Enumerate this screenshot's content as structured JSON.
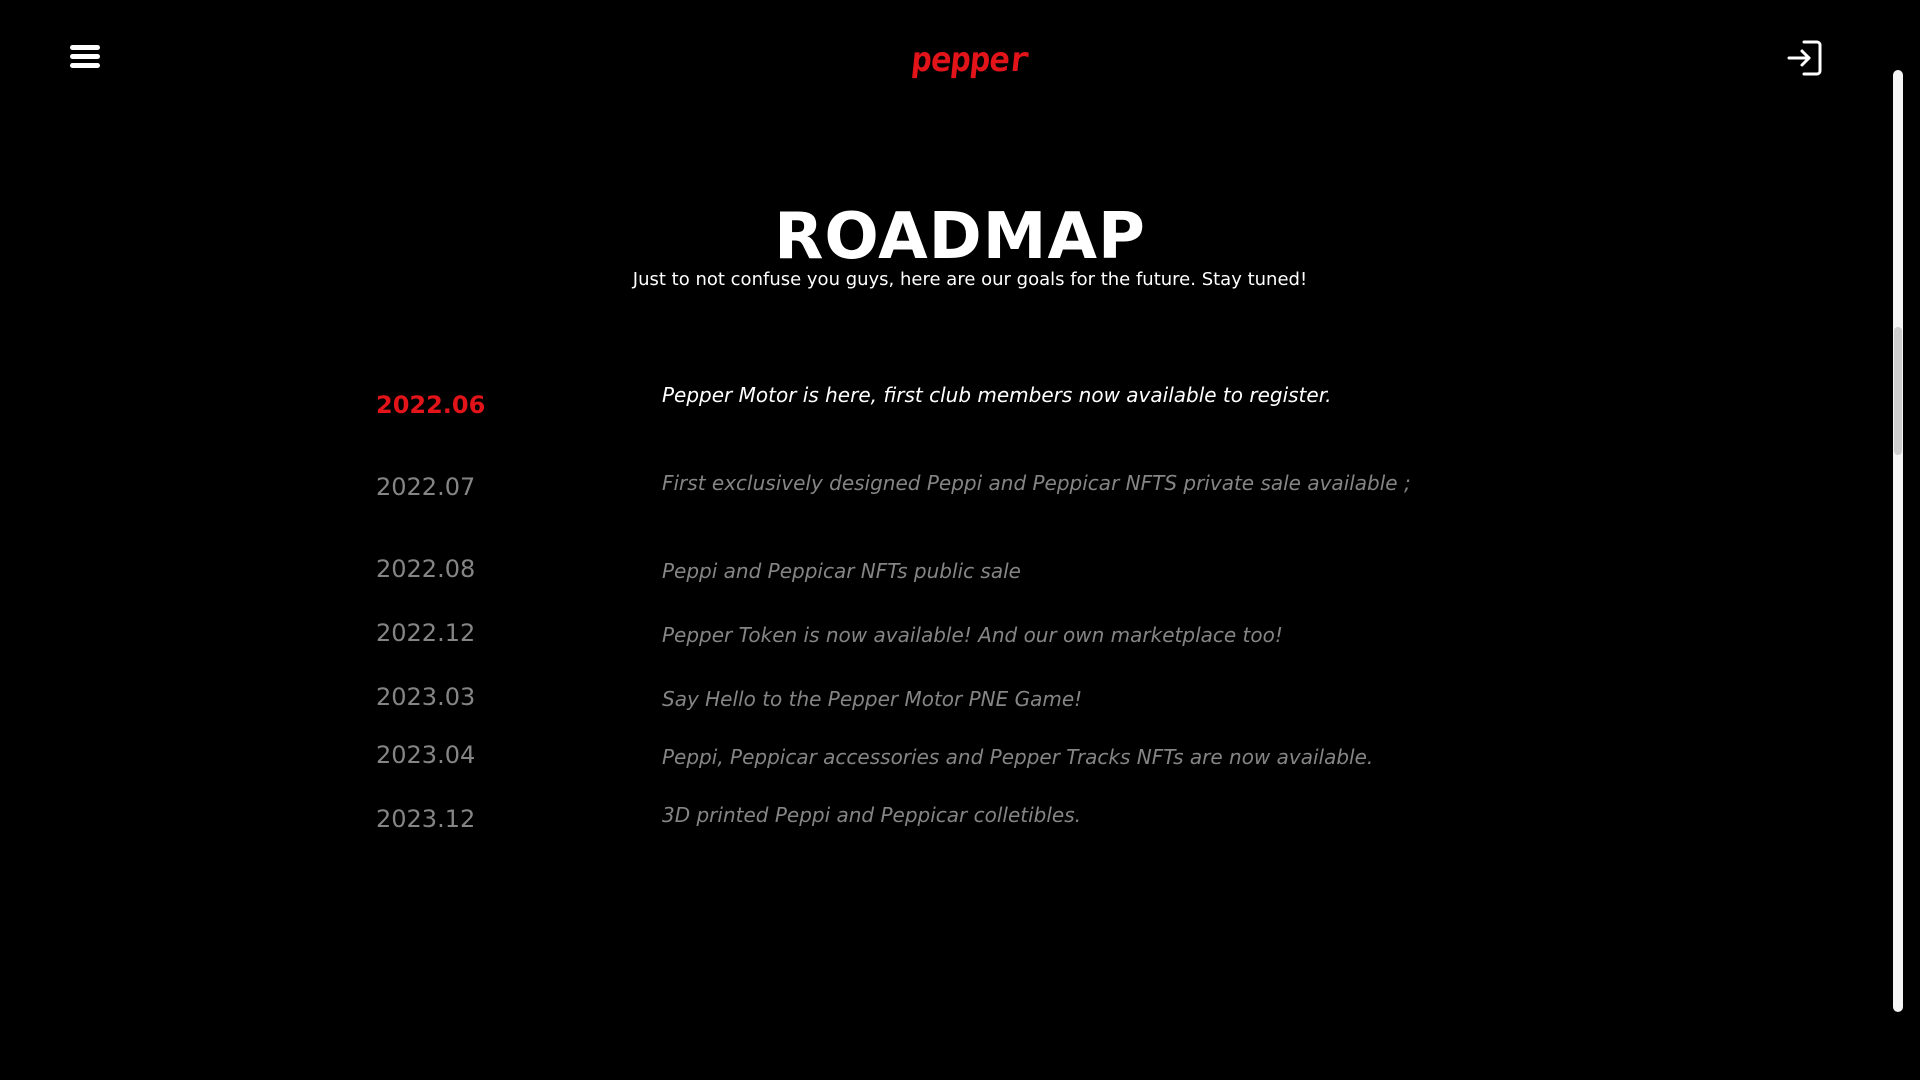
{
  "header": {
    "logo_text": "pepper",
    "menu_icon": "hamburger-menu-icon",
    "signin_icon": "sign-in-arrow-icon",
    "brand_color": "#e2141a"
  },
  "main": {
    "title": "ROADMAP",
    "subtitle": "Just to not confuse you guys, here are our goals for the future. Stay tuned!"
  },
  "roadmap": {
    "items": [
      {
        "date": "2022.06",
        "text": "Pepper Motor is here, first club members now available to register.",
        "active": true
      },
      {
        "date": "2022.07",
        "text": "First exclusively designed Peppi and Peppicar NFTS private sale available ;",
        "active": false
      },
      {
        "date": "2022.08",
        "text": "Peppi and Peppicar NFTs public sale",
        "active": false
      },
      {
        "date": "2022.12",
        "text": "Pepper Token is now available! And our own marketplace too!",
        "active": false
      },
      {
        "date": "2023.03",
        "text": "Say Hello to the Pepper Motor PNE Game!",
        "active": false
      },
      {
        "date": "2023.04",
        "text": "Peppi, Peppicar accessories and Pepper Tracks NFTs are now available.",
        "active": false
      },
      {
        "date": "2023.12",
        "text": "3D printed Peppi and Peppicar colletibles.",
        "active": false
      }
    ]
  },
  "colors": {
    "active_date": "#e2141a",
    "active_text": "#ffffff",
    "inactive": "#858585",
    "background": "#000000"
  }
}
